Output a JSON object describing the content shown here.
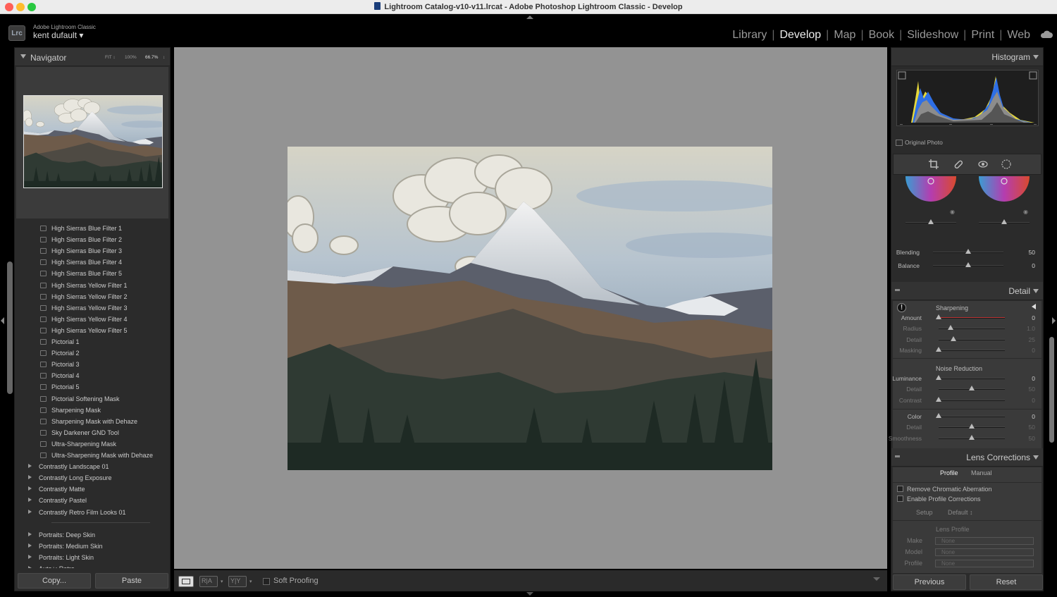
{
  "window": {
    "title": "Lightroom Catalog-v10-v11.lrcat - Adobe Photoshop Lightroom Classic - Develop"
  },
  "identity": {
    "logo": "Lrc",
    "brand": "Adobe Lightroom Classic",
    "user": "kent dufault"
  },
  "modules": [
    "Library",
    "Develop",
    "Map",
    "Book",
    "Slideshow",
    "Print",
    "Web"
  ],
  "active_module": "Develop",
  "navigator": {
    "title": "Navigator",
    "zoom_fit": "FIT ↕",
    "zoom_100": "100%",
    "zoom_current": "66.7%"
  },
  "presets": {
    "items": [
      "High Sierras Blue Filter 1",
      "High Sierras Blue Filter 2",
      "High Sierras Blue Filter 3",
      "High Sierras Blue Filter 4",
      "High Sierras Blue Filter 5",
      "High Sierras Yellow Filter 1",
      "High Sierras Yellow Filter 2",
      "High Sierras Yellow Filter 3",
      "High Sierras Yellow Filter 4",
      "High Sierras Yellow Filter 5",
      "Pictorial 1",
      "Pictorial 2",
      "Pictorial 3",
      "Pictorial 4",
      "Pictorial 5",
      "Pictorial Softening Mask",
      "Sharpening Mask",
      "Sharpening Mask with Dehaze",
      "Sky Darkener GND Tool",
      "Ultra-Sharpening Mask",
      "Ultra-Sharpening Mask with Dehaze"
    ],
    "groups": [
      "Contrastly Landscape 01",
      "Contrastly Long Exposure",
      "Contrastly Matte",
      "Contrastly Pastel",
      "Contrastly Retro Film Looks 01"
    ],
    "groups2": [
      "Portraits: Deep Skin",
      "Portraits: Medium Skin",
      "Portraits: Light Skin",
      "Auto+: Retro"
    ]
  },
  "left_buttons": {
    "copy": "Copy...",
    "paste": "Paste"
  },
  "toolbar": {
    "soft_proofing": "Soft Proofing"
  },
  "histogram": {
    "title": "Histogram",
    "original_photo": "Original Photo"
  },
  "color_grading": {
    "blending_label": "Blending",
    "blending_value": "50",
    "blending_level": 0.5,
    "balance_label": "Balance",
    "balance_value": "0",
    "balance_level": 0.5
  },
  "detail": {
    "title": "Detail",
    "sharpening": {
      "title": "Sharpening",
      "sliders": [
        {
          "label": "Amount",
          "value": "0",
          "level": 0.0,
          "dim": false
        },
        {
          "label": "Radius",
          "value": "1.0",
          "level": 0.18,
          "dim": true
        },
        {
          "label": "Detail",
          "value": "25",
          "level": 0.22,
          "dim": true
        },
        {
          "label": "Masking",
          "value": "0",
          "level": 0.0,
          "dim": true
        }
      ]
    },
    "noise_reduction": {
      "title": "Noise Reduction",
      "sliders": [
        {
          "label": "Luminance",
          "value": "0",
          "level": 0.0,
          "dim": false
        },
        {
          "label": "Detail",
          "value": "50",
          "level": 0.5,
          "dim": true
        },
        {
          "label": "Contrast",
          "value": "0",
          "level": 0.0,
          "dim": true
        },
        {
          "label": "Color",
          "value": "0",
          "level": 0.0,
          "dim": false
        },
        {
          "label": "Detail",
          "value": "50",
          "level": 0.5,
          "dim": true
        },
        {
          "label": "Smoothness",
          "value": "50",
          "level": 0.5,
          "dim": true
        }
      ]
    }
  },
  "lens": {
    "title": "Lens Corrections",
    "tabs": [
      "Profile",
      "Manual"
    ],
    "remove_ca": "Remove Chromatic Aberration",
    "enable_profile": "Enable Profile Corrections",
    "setup_label": "Setup",
    "setup_value": "Default ↕",
    "lens_profile": "Lens Profile",
    "make_label": "Make",
    "make_value": "None",
    "model_label": "Model",
    "model_value": "None",
    "profile_label": "Profile",
    "profile_value": "None"
  },
  "right_buttons": {
    "previous": "Previous",
    "reset": "Reset"
  },
  "colors": {
    "app_bg": "#000000",
    "panel_bg": "#2b2b2b",
    "canvas_bg": "#939393",
    "histogram_yellow": "#e8e23a",
    "histogram_blue": "#2d6fe0"
  }
}
